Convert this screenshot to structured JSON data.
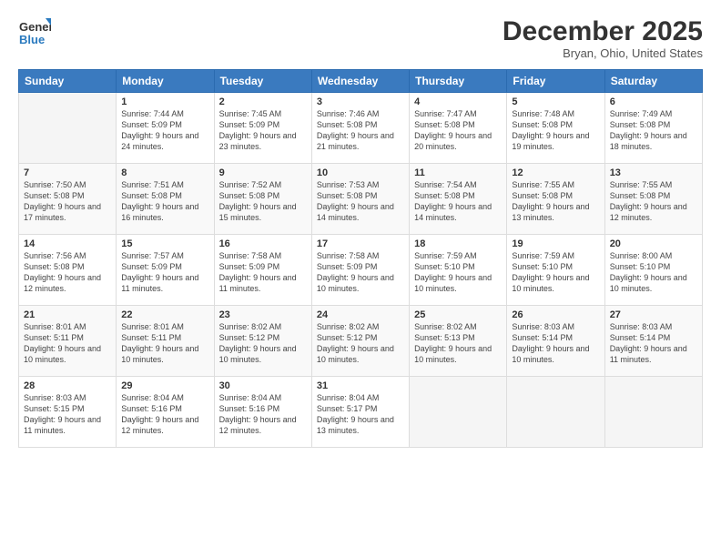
{
  "logo": {
    "general": "General",
    "blue": "Blue"
  },
  "header": {
    "month": "December 2025",
    "location": "Bryan, Ohio, United States"
  },
  "weekdays": [
    "Sunday",
    "Monday",
    "Tuesday",
    "Wednesday",
    "Thursday",
    "Friday",
    "Saturday"
  ],
  "weeks": [
    [
      {
        "day": "",
        "sunrise": "",
        "sunset": "",
        "daylight": ""
      },
      {
        "day": "1",
        "sunrise": "Sunrise: 7:44 AM",
        "sunset": "Sunset: 5:09 PM",
        "daylight": "Daylight: 9 hours and 24 minutes."
      },
      {
        "day": "2",
        "sunrise": "Sunrise: 7:45 AM",
        "sunset": "Sunset: 5:09 PM",
        "daylight": "Daylight: 9 hours and 23 minutes."
      },
      {
        "day": "3",
        "sunrise": "Sunrise: 7:46 AM",
        "sunset": "Sunset: 5:08 PM",
        "daylight": "Daylight: 9 hours and 21 minutes."
      },
      {
        "day": "4",
        "sunrise": "Sunrise: 7:47 AM",
        "sunset": "Sunset: 5:08 PM",
        "daylight": "Daylight: 9 hours and 20 minutes."
      },
      {
        "day": "5",
        "sunrise": "Sunrise: 7:48 AM",
        "sunset": "Sunset: 5:08 PM",
        "daylight": "Daylight: 9 hours and 19 minutes."
      },
      {
        "day": "6",
        "sunrise": "Sunrise: 7:49 AM",
        "sunset": "Sunset: 5:08 PM",
        "daylight": "Daylight: 9 hours and 18 minutes."
      }
    ],
    [
      {
        "day": "7",
        "sunrise": "Sunrise: 7:50 AM",
        "sunset": "Sunset: 5:08 PM",
        "daylight": "Daylight: 9 hours and 17 minutes."
      },
      {
        "day": "8",
        "sunrise": "Sunrise: 7:51 AM",
        "sunset": "Sunset: 5:08 PM",
        "daylight": "Daylight: 9 hours and 16 minutes."
      },
      {
        "day": "9",
        "sunrise": "Sunrise: 7:52 AM",
        "sunset": "Sunset: 5:08 PM",
        "daylight": "Daylight: 9 hours and 15 minutes."
      },
      {
        "day": "10",
        "sunrise": "Sunrise: 7:53 AM",
        "sunset": "Sunset: 5:08 PM",
        "daylight": "Daylight: 9 hours and 14 minutes."
      },
      {
        "day": "11",
        "sunrise": "Sunrise: 7:54 AM",
        "sunset": "Sunset: 5:08 PM",
        "daylight": "Daylight: 9 hours and 14 minutes."
      },
      {
        "day": "12",
        "sunrise": "Sunrise: 7:55 AM",
        "sunset": "Sunset: 5:08 PM",
        "daylight": "Daylight: 9 hours and 13 minutes."
      },
      {
        "day": "13",
        "sunrise": "Sunrise: 7:55 AM",
        "sunset": "Sunset: 5:08 PM",
        "daylight": "Daylight: 9 hours and 12 minutes."
      }
    ],
    [
      {
        "day": "14",
        "sunrise": "Sunrise: 7:56 AM",
        "sunset": "Sunset: 5:08 PM",
        "daylight": "Daylight: 9 hours and 12 minutes."
      },
      {
        "day": "15",
        "sunrise": "Sunrise: 7:57 AM",
        "sunset": "Sunset: 5:09 PM",
        "daylight": "Daylight: 9 hours and 11 minutes."
      },
      {
        "day": "16",
        "sunrise": "Sunrise: 7:58 AM",
        "sunset": "Sunset: 5:09 PM",
        "daylight": "Daylight: 9 hours and 11 minutes."
      },
      {
        "day": "17",
        "sunrise": "Sunrise: 7:58 AM",
        "sunset": "Sunset: 5:09 PM",
        "daylight": "Daylight: 9 hours and 10 minutes."
      },
      {
        "day": "18",
        "sunrise": "Sunrise: 7:59 AM",
        "sunset": "Sunset: 5:10 PM",
        "daylight": "Daylight: 9 hours and 10 minutes."
      },
      {
        "day": "19",
        "sunrise": "Sunrise: 7:59 AM",
        "sunset": "Sunset: 5:10 PM",
        "daylight": "Daylight: 9 hours and 10 minutes."
      },
      {
        "day": "20",
        "sunrise": "Sunrise: 8:00 AM",
        "sunset": "Sunset: 5:10 PM",
        "daylight": "Daylight: 9 hours and 10 minutes."
      }
    ],
    [
      {
        "day": "21",
        "sunrise": "Sunrise: 8:01 AM",
        "sunset": "Sunset: 5:11 PM",
        "daylight": "Daylight: 9 hours and 10 minutes."
      },
      {
        "day": "22",
        "sunrise": "Sunrise: 8:01 AM",
        "sunset": "Sunset: 5:11 PM",
        "daylight": "Daylight: 9 hours and 10 minutes."
      },
      {
        "day": "23",
        "sunrise": "Sunrise: 8:02 AM",
        "sunset": "Sunset: 5:12 PM",
        "daylight": "Daylight: 9 hours and 10 minutes."
      },
      {
        "day": "24",
        "sunrise": "Sunrise: 8:02 AM",
        "sunset": "Sunset: 5:12 PM",
        "daylight": "Daylight: 9 hours and 10 minutes."
      },
      {
        "day": "25",
        "sunrise": "Sunrise: 8:02 AM",
        "sunset": "Sunset: 5:13 PM",
        "daylight": "Daylight: 9 hours and 10 minutes."
      },
      {
        "day": "26",
        "sunrise": "Sunrise: 8:03 AM",
        "sunset": "Sunset: 5:14 PM",
        "daylight": "Daylight: 9 hours and 10 minutes."
      },
      {
        "day": "27",
        "sunrise": "Sunrise: 8:03 AM",
        "sunset": "Sunset: 5:14 PM",
        "daylight": "Daylight: 9 hours and 11 minutes."
      }
    ],
    [
      {
        "day": "28",
        "sunrise": "Sunrise: 8:03 AM",
        "sunset": "Sunset: 5:15 PM",
        "daylight": "Daylight: 9 hours and 11 minutes."
      },
      {
        "day": "29",
        "sunrise": "Sunrise: 8:04 AM",
        "sunset": "Sunset: 5:16 PM",
        "daylight": "Daylight: 9 hours and 12 minutes."
      },
      {
        "day": "30",
        "sunrise": "Sunrise: 8:04 AM",
        "sunset": "Sunset: 5:16 PM",
        "daylight": "Daylight: 9 hours and 12 minutes."
      },
      {
        "day": "31",
        "sunrise": "Sunrise: 8:04 AM",
        "sunset": "Sunset: 5:17 PM",
        "daylight": "Daylight: 9 hours and 13 minutes."
      },
      {
        "day": "",
        "sunrise": "",
        "sunset": "",
        "daylight": ""
      },
      {
        "day": "",
        "sunrise": "",
        "sunset": "",
        "daylight": ""
      },
      {
        "day": "",
        "sunrise": "",
        "sunset": "",
        "daylight": ""
      }
    ]
  ]
}
